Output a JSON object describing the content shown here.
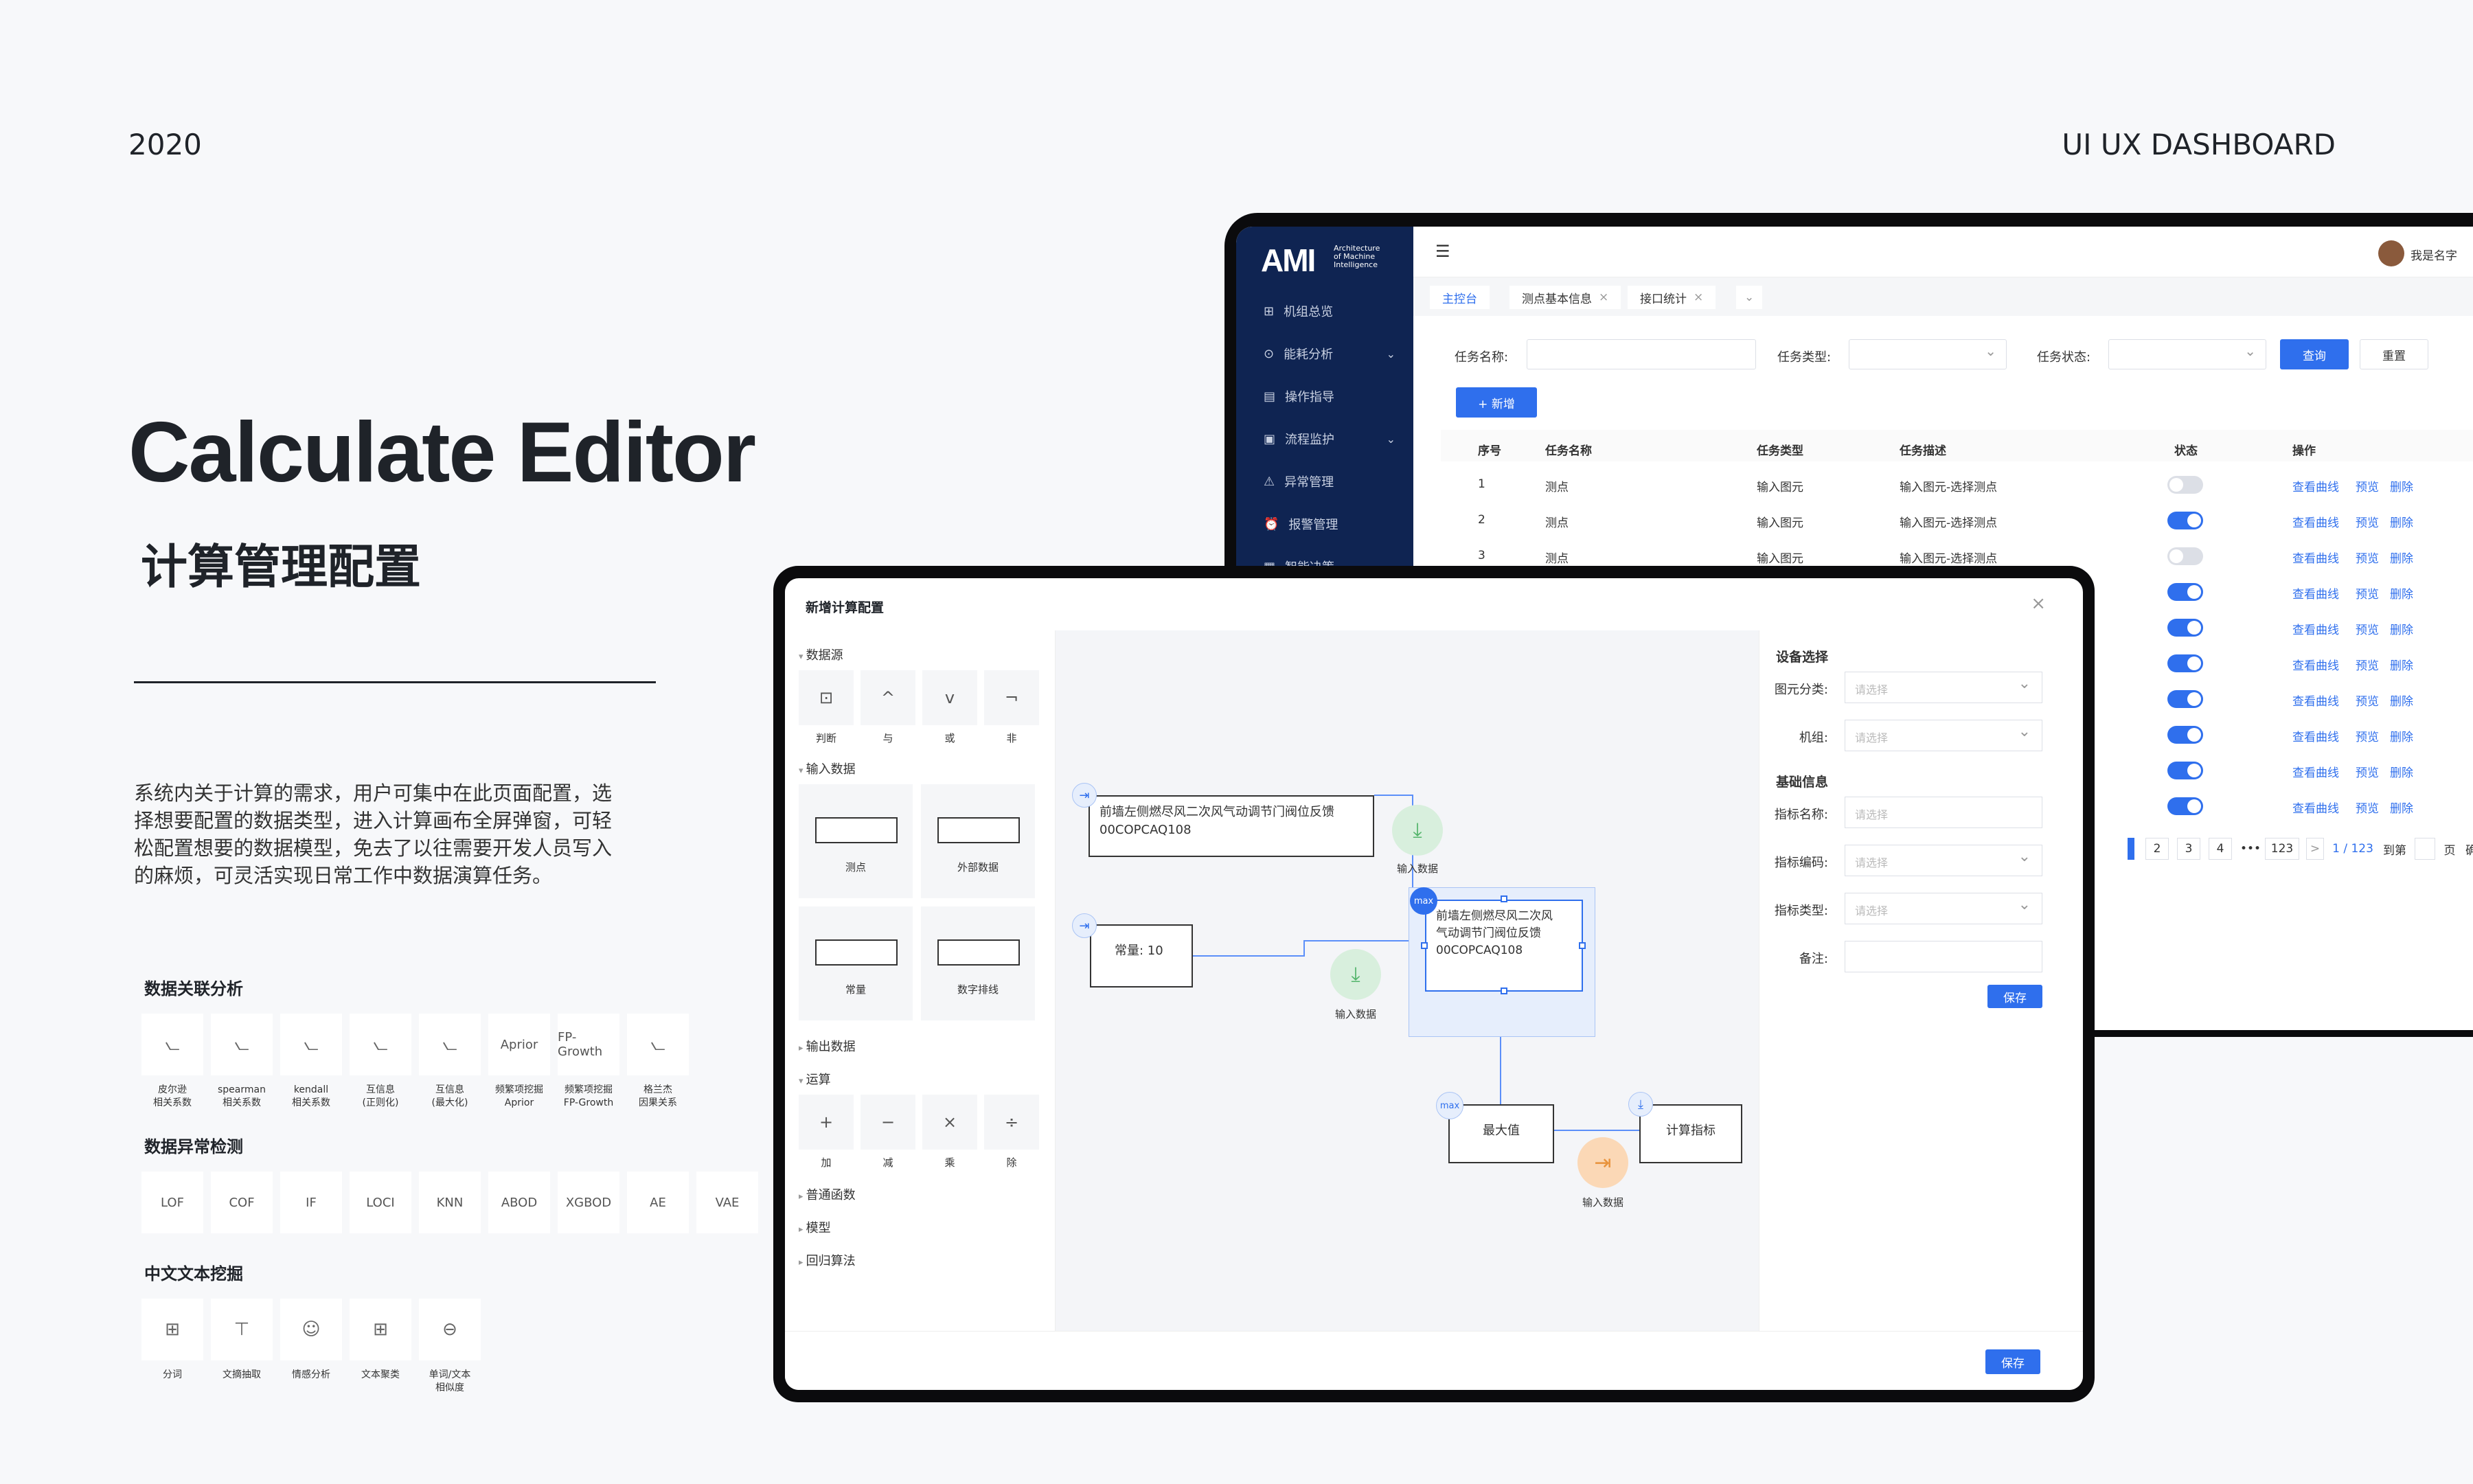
{
  "header": {
    "year": "2020",
    "brand": "UI UX DASHBOARD"
  },
  "hero": {
    "title": "Calculate Editor",
    "subtitle": "计算管理配置",
    "description": "系统内关于计算的需求，用户可集中在此页面配置，选择想要配置的数据类型，进入计算画布全屏弹窗，可轻松配置想要的数据模型，免去了以往需要开发人员写入的麻烦，可灵活实现日常工作中数据演算任务。"
  },
  "sections": [
    {
      "title": "数据关联分析",
      "items": [
        {
          "icon": "line-chart-icon",
          "label": "皮尔逊\n相关系数"
        },
        {
          "icon": "line-chart-icon",
          "label": "spearman\n相关系数"
        },
        {
          "icon": "line-chart-icon",
          "label": "kendall\n相关系数"
        },
        {
          "icon": "line-chart-icon",
          "label": "互信息\n(正则化)"
        },
        {
          "icon": "line-chart-icon",
          "label": "互信息\n(最大化)"
        },
        {
          "text": "Aprior",
          "label": "频繁项挖掘\nAprior"
        },
        {
          "text": "FP-Growth",
          "label": "频繁项挖掘\nFP-Growth"
        },
        {
          "icon": "line-chart-icon",
          "label": "格兰杰\n因果关系"
        }
      ]
    },
    {
      "title": "数据异常检测",
      "items": [
        {
          "text": "LOF"
        },
        {
          "text": "COF"
        },
        {
          "text": "IF"
        },
        {
          "text": "LOCI"
        },
        {
          "text": "KNN"
        },
        {
          "text": "ABOD"
        },
        {
          "text": "XGBOD"
        },
        {
          "text": "AE"
        },
        {
          "text": "VAE"
        }
      ]
    },
    {
      "title": "中文文本挖掘",
      "items": [
        {
          "icon": "grid-icon",
          "label": "分词"
        },
        {
          "icon": "text-icon",
          "label": "文摘抽取"
        },
        {
          "icon": "smile-icon",
          "label": "情感分析"
        },
        {
          "icon": "grid-icon",
          "label": "文本聚类"
        },
        {
          "icon": "link-icon",
          "label": "单词/文本\n相似度"
        }
      ]
    }
  ],
  "dashboard": {
    "logo": "AMI",
    "logo_sub": "Architecture\nof Machine\nIntelligence",
    "user": "我是名字",
    "menu": [
      {
        "icon": "grid-icon",
        "label": "机组总览"
      },
      {
        "icon": "energy-icon",
        "label": "能耗分析",
        "chevron": true
      },
      {
        "icon": "doc-icon",
        "label": "操作指导"
      },
      {
        "icon": "monitor-icon",
        "label": "流程监护",
        "chevron": true
      },
      {
        "icon": "warning-icon",
        "label": "异常管理"
      },
      {
        "icon": "alarm-icon",
        "label": "报警管理"
      },
      {
        "icon": "data-icon",
        "label": "智能决策"
      }
    ],
    "tabs": [
      {
        "label": "主控台",
        "active": true
      },
      {
        "label": "测点基本信息",
        "close": "×"
      },
      {
        "label": "接口统计",
        "close": "×"
      }
    ],
    "tab_more": "⌄",
    "filters": {
      "name_label": "任务名称:",
      "type_label": "任务类型:",
      "status_label": "任务状态:",
      "query": "查询",
      "reset": "重置",
      "add": "+ 新增"
    },
    "columns": [
      "序号",
      "任务名称",
      "任务类型",
      "任务描述",
      "状态",
      "操作"
    ],
    "rows": [
      {
        "no": "1",
        "name": "测点",
        "type": "输入图元",
        "desc": "输入图元-选择测点",
        "on": false
      },
      {
        "no": "2",
        "name": "测点",
        "type": "输入图元",
        "desc": "输入图元-选择测点",
        "on": true
      },
      {
        "no": "3",
        "name": "测点",
        "type": "输入图元",
        "desc": "输入图元-选择测点",
        "on": false
      },
      {
        "on": true
      },
      {
        "on": true
      },
      {
        "on": true
      },
      {
        "on": true
      },
      {
        "on": true
      },
      {
        "on": true
      },
      {
        "on": true
      }
    ],
    "ops": [
      "查看曲线",
      "预览",
      "删除"
    ],
    "pager": {
      "pages": [
        "2",
        "3",
        "4"
      ],
      "ellipsis": "•••",
      "last": "123",
      "next": ">",
      "info": "1 / 123",
      "goto": "到第",
      "page": "页",
      "confirm": "确认"
    }
  },
  "modal": {
    "title": "新增计算配置",
    "close": "×",
    "palette": {
      "datasource": "数据源",
      "logic": [
        {
          "icon": "judge-icon",
          "glyph": "⊡",
          "label": "判断"
        },
        {
          "icon": "and-icon",
          "glyph": "^",
          "label": "与"
        },
        {
          "icon": "or-icon",
          "glyph": "v",
          "label": "或"
        },
        {
          "icon": "not-icon",
          "glyph": "¬",
          "label": "非"
        }
      ],
      "input": "输入数据",
      "input_items": [
        "测点",
        "外部数据",
        "常量",
        "数字排线"
      ],
      "output": "输出数据",
      "ops": "运算",
      "op_items": [
        {
          "glyph": "+",
          "label": "加"
        },
        {
          "glyph": "−",
          "label": "减"
        },
        {
          "glyph": "×",
          "label": "乘"
        },
        {
          "glyph": "÷",
          "label": "除"
        }
      ],
      "more": [
        "普通函数",
        "模型",
        "回归算法"
      ]
    },
    "canvas": {
      "node1": {
        "line1": "前墙左侧燃尽风二次风气动调节门阀位反馈",
        "line2": "00COPCAQ108"
      },
      "node2": {
        "line1": "常量: 10"
      },
      "node3": {
        "line1": "前墙左侧燃尽风二次风",
        "line2": "气动调节门阀位反馈",
        "line3": "00COPCAQ108",
        "badge": "max"
      },
      "node4": {
        "line1": "最大值",
        "badge": "max"
      },
      "node5": {
        "line1": "计算指标"
      },
      "input_label": "输入数据"
    },
    "props": {
      "device_section": "设备选择",
      "type_label": "图元分类:",
      "unit_label": "机组:",
      "basic_section": "基础信息",
      "name_label": "指标名称:",
      "code_label": "指标编码:",
      "kind_label": "指标类型:",
      "note_label": "备注:",
      "placeholder": "请选择",
      "save": "保存"
    },
    "footer_save": "保存"
  },
  "colors": {
    "accent": "#2f6fed",
    "sidebar": "#0f2452",
    "green": "#d8efdd",
    "orange": "#fbd8b6"
  }
}
